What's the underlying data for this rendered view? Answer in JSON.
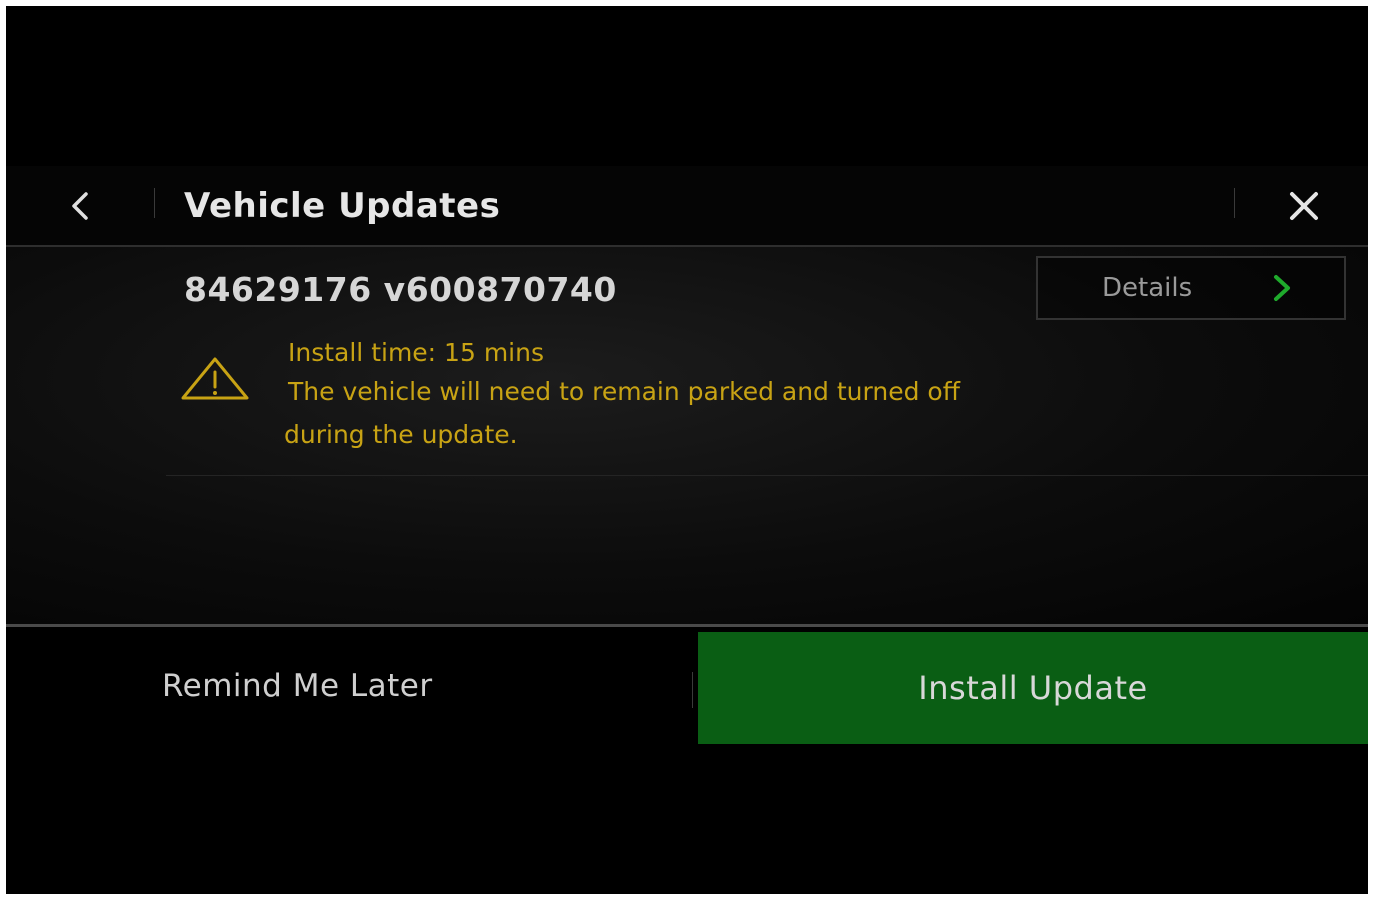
{
  "header": {
    "title": "Vehicle Updates",
    "back_icon": "chevron-left-icon",
    "close_icon": "close-icon"
  },
  "update": {
    "version": "84629176 v600870740",
    "details_label": "Details",
    "details_icon": "chevron-right-icon",
    "warning_icon": "warning-triangle-icon",
    "install_time": "Install time: 15 mins",
    "notice_line1": "The vehicle will need to remain parked and turned off",
    "notice_line2": "during the update."
  },
  "footer": {
    "remind_label": "Remind Me Later",
    "install_label": "Install Update"
  },
  "colors": {
    "background": "#000000",
    "accent_green": "#0a5e14",
    "chevron_green": "#1faa2c",
    "warning_yellow": "#c8a314"
  }
}
